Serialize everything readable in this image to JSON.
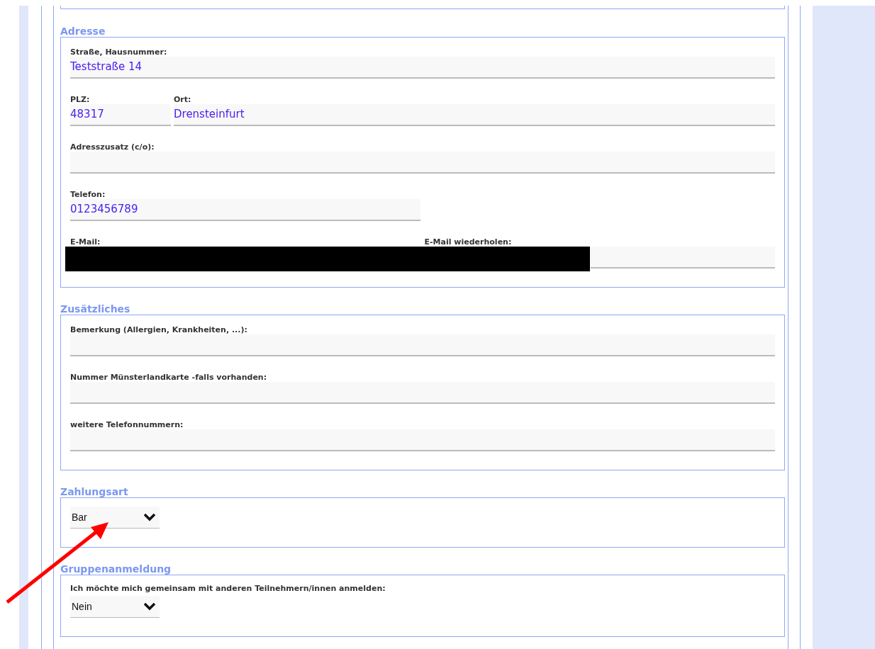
{
  "sections": [
    {
      "title": "Adresse",
      "rows": [
        {
          "kind": "wide",
          "fields": [
            {
              "kind": "text",
              "label": "Straße, Hausnummer:",
              "value": "Teststraße 14"
            }
          ]
        },
        {
          "kind": "zip-city",
          "fields": [
            {
              "kind": "text",
              "label": "PLZ:",
              "value": "48317"
            },
            {
              "kind": "text",
              "label": "Ort:",
              "value": "Drensteinfurt"
            }
          ]
        },
        {
          "kind": "wide",
          "fields": [
            {
              "kind": "text",
              "label": "Adresszusatz (c/o):"
            }
          ]
        },
        {
          "kind": "half",
          "fields": [
            {
              "kind": "text",
              "label": "Telefon:",
              "value": "0123456789"
            }
          ]
        },
        {
          "kind": "pair",
          "redacted": true,
          "fields": [
            {
              "kind": "text",
              "label": "E-Mail:"
            },
            {
              "kind": "text",
              "label": "E-Mail wiederholen:"
            }
          ]
        }
      ]
    },
    {
      "title": "Zusätzliches",
      "rows": [
        {
          "kind": "wide",
          "fields": [
            {
              "kind": "text",
              "label": "Bemerkung (Allergien, Krankheiten, ...):"
            }
          ]
        },
        {
          "kind": "wide",
          "fields": [
            {
              "kind": "text",
              "label": "Nummer Münsterlandkarte -falls vorhanden:"
            }
          ]
        },
        {
          "kind": "wide",
          "fields": [
            {
              "kind": "text",
              "label": "weitere Telefonnummern:"
            }
          ]
        }
      ]
    },
    {
      "title": "Zahlungsart",
      "rows": [
        {
          "kind": "compact",
          "fields": [
            {
              "kind": "select",
              "value": "Bar"
            }
          ]
        }
      ]
    },
    {
      "title": "Gruppenanmeldung",
      "rows": [
        {
          "kind": "compact",
          "fields": [
            {
              "kind": "select",
              "label": "Ich möchte mich gemeinsam mit anderen Teilnehmern/innen anmelden:",
              "value": "Nein"
            }
          ]
        }
      ]
    }
  ],
  "annotation": {
    "kind": "arrow"
  }
}
